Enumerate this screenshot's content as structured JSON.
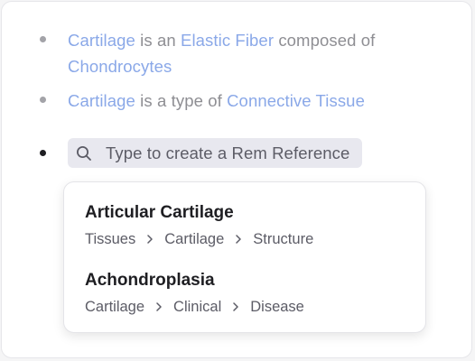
{
  "bullets": [
    {
      "parts": [
        {
          "text": "Cartilage",
          "ref": true
        },
        {
          "text": " is an ",
          "ref": false
        },
        {
          "text": "Elastic Fiber",
          "ref": true
        },
        {
          "text": " composed of ",
          "ref": false
        },
        {
          "text": "Chondrocytes",
          "ref": true
        }
      ]
    },
    {
      "parts": [
        {
          "text": "Cartilage",
          "ref": true
        },
        {
          "text": " is a type of ",
          "ref": false
        },
        {
          "text": "Connective Tissue",
          "ref": true
        }
      ]
    }
  ],
  "search": {
    "icon": "search-icon",
    "placeholder": "Type to create a Rem Reference"
  },
  "results": [
    {
      "title": "Articular Cartilage",
      "path": [
        "Tissues",
        "Cartilage",
        "Structure"
      ]
    },
    {
      "title": "Achondroplasia",
      "path": [
        "Cartilage",
        "Clinical",
        "Disease"
      ]
    }
  ],
  "colors": {
    "reference": "#8aa8e8",
    "muted_text": "#8e8e93",
    "dark_text": "#1e1e22",
    "search_bg": "#e8e8ef"
  }
}
